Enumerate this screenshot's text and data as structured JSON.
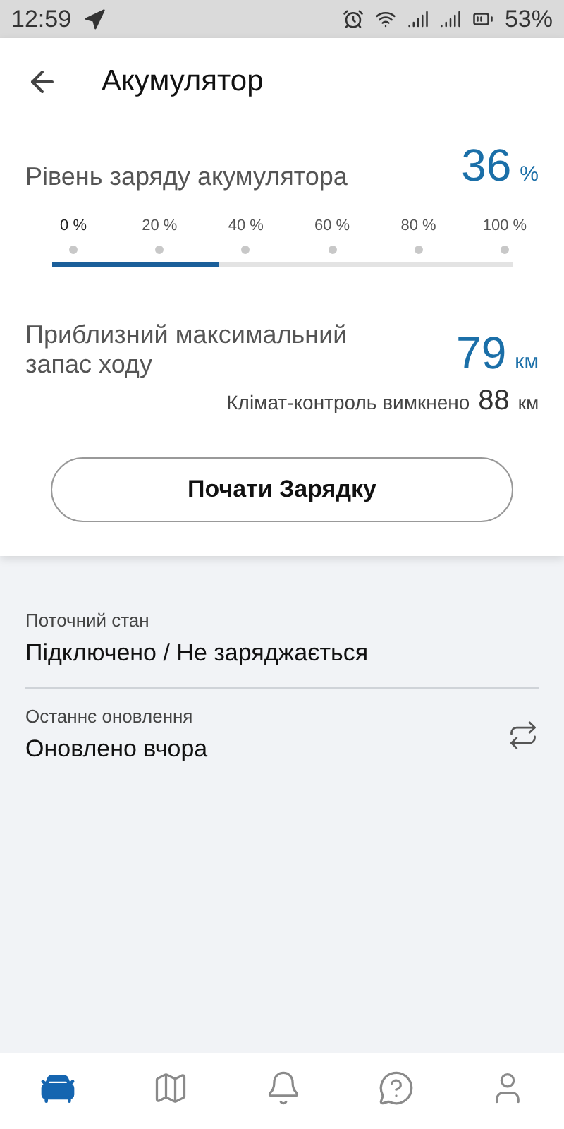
{
  "status_bar": {
    "time": "12:59",
    "battery": "53%"
  },
  "header": {
    "title": "Акумулятор"
  },
  "charge": {
    "label": "Рівень заряду акумулятора",
    "value": "36",
    "unit": "%",
    "level": 0.36,
    "ticks": [
      "0 %",
      "20 %",
      "40 %",
      "60 %",
      "80 %",
      "100 %"
    ]
  },
  "range": {
    "label": "Приблизний максимальний запас ходу",
    "value": "79",
    "unit": "км",
    "climate_label": "Клімат-контроль вимкнено",
    "climate_value": "88",
    "climate_unit": "км"
  },
  "start_button": "Почати Зарядку",
  "info": [
    {
      "label": "Поточний стан",
      "value": "Підключено / Не заряджається",
      "kind": "plain"
    },
    {
      "label": "Останнє оновлення",
      "value": "Оновлено вчора",
      "kind": "refresh"
    }
  ],
  "nav": [
    {
      "kind": "car",
      "selected": true
    },
    {
      "kind": "map",
      "selected": false
    },
    {
      "kind": "bell",
      "selected": false
    },
    {
      "kind": "help",
      "selected": false
    },
    {
      "kind": "user",
      "selected": false
    }
  ]
}
